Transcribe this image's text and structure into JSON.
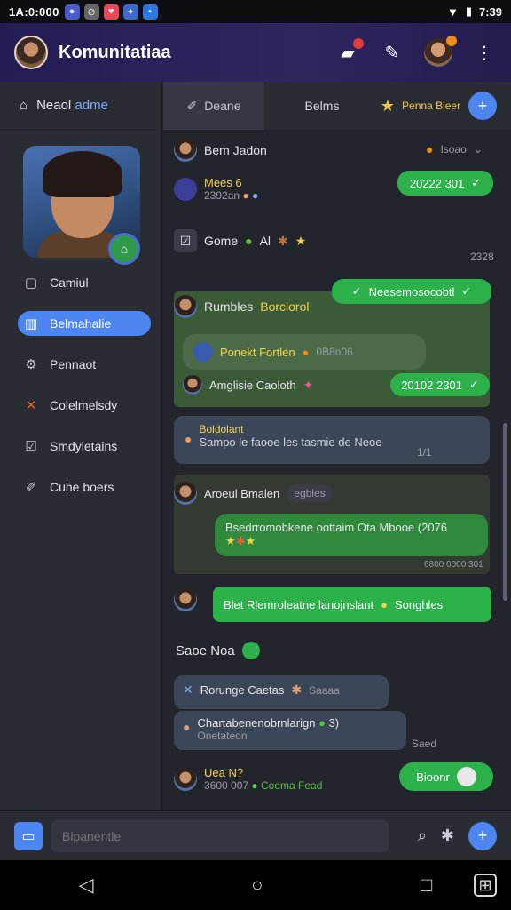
{
  "status_bar": {
    "time_left": "1A:0:000",
    "time_right": "7:39"
  },
  "app_bar": {
    "title": "Komunitatiaa"
  },
  "sidebar": {
    "header_prefix": "Neaol",
    "header_accent": "adme",
    "items": [
      {
        "label": "Camiul",
        "icon": "folder-icon"
      },
      {
        "label": "Belmahalie",
        "icon": "chat-icon",
        "active": true
      },
      {
        "label": "Pennaot",
        "icon": "gear-icon"
      },
      {
        "label": "Colelmelsdy",
        "icon": "sword-icon"
      },
      {
        "label": "Smdyletains",
        "icon": "checkbox-icon"
      },
      {
        "label": "Cuhe boers",
        "icon": "brush-icon"
      }
    ]
  },
  "tabs": [
    {
      "label": "Deane",
      "icon": "brush-icon"
    },
    {
      "label": "Belms"
    },
    {
      "label": "Penna Bieer",
      "icon": "star-icon"
    }
  ],
  "chat": {
    "header_name": "Bem Jadon",
    "header_meta": "Isoao",
    "msg1_title": "Mees 6",
    "msg1_sub": "2392an",
    "msg1_pill": "20222 301",
    "game_label": "Gome",
    "game_sub": "Al",
    "time1": "2328",
    "top_pill": "Neesemosocobtl",
    "section_name": "Rumbles",
    "section_accent": "Borclorol",
    "sub1_name": "Ponekt Fortlen",
    "sub1_meta": "0B8n06",
    "sub2_name": "Amglisie Caoloth",
    "sub2_pill": "20102 2301",
    "blue_title": "Boldolant",
    "blue_text": "Sampo le faooe les tasmie de Neoe",
    "blue_time": "1/1",
    "box3_name": "Aroeul Bmalen",
    "box3_meta": "egbles",
    "box3_text": "Bsedrromobkene oottaim Ota Mbooe (2076",
    "box3_time": "6800 0000 301",
    "wide_pill": "Blet Rlemroleatne lanojnslant",
    "wide_meta": "Songhles",
    "section2": "Saoe Noa",
    "card1_name": "Rorunge Caetas",
    "card1_meta": "Saaaa",
    "card2_text": "Chartabenenobrnlarign",
    "card2_sub": "Onetateon",
    "card2_count": "3)",
    "card2_time": "Saed",
    "last_name": "Uea N?",
    "last_sub": "3600 007",
    "last_sub2": "Coema Fead",
    "last_pill": "Bioonr"
  },
  "composer": {
    "placeholder": "Bipanentle"
  },
  "colors": {
    "accent": "#4d86f0",
    "green": "#2db14a",
    "appbar": "#2a2360"
  }
}
